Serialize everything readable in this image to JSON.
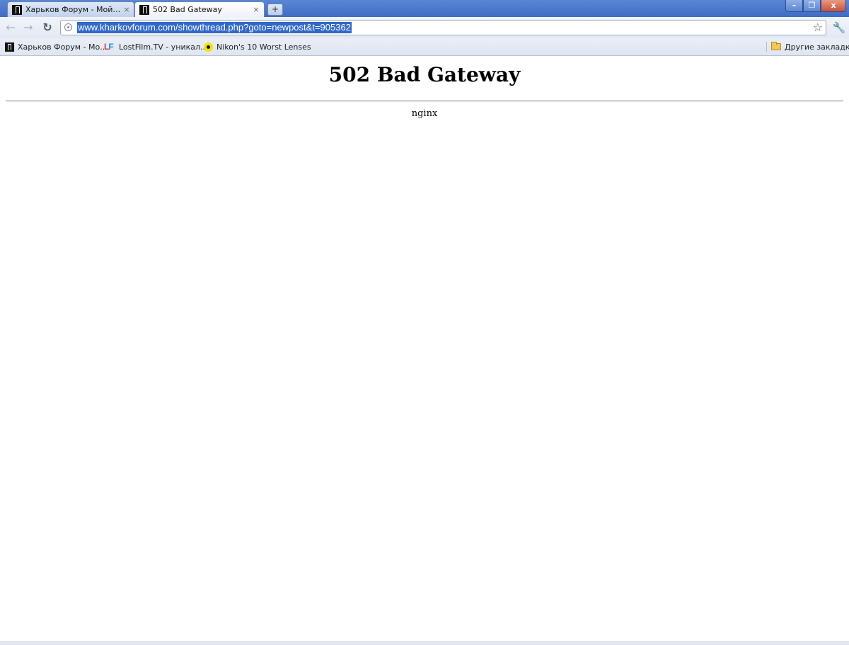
{
  "tabs": [
    {
      "title": "Харьков Форум - Мой каб...",
      "close": "×",
      "active": false
    },
    {
      "title": "502 Bad Gateway",
      "close": "×",
      "active": true
    }
  ],
  "new_tab_label": "+",
  "window_controls": {
    "minimize": "–",
    "maximize": "❐",
    "close": "x"
  },
  "toolbar": {
    "back": "←",
    "forward": "→",
    "reload": "↻",
    "url": "www.kharkovforum.com/showthread.php?goto=newpost&t=905362",
    "star": "☆",
    "wrench": "🔧"
  },
  "bookmarks": {
    "items": [
      {
        "label": "Харьков Форум - Мо...",
        "icon": "kharkov-favicon"
      },
      {
        "label": "LostFilm.TV - уникал...",
        "icon": "lostfilm-favicon",
        "icon_text_l": "L",
        "icon_text_f": "F"
      },
      {
        "label": "Nikon's 10 Worst Lenses",
        "icon": "nikon-favicon"
      }
    ],
    "other": "Другие закладки"
  },
  "page": {
    "title": "502 Bad Gateway",
    "server": "nginx"
  },
  "colors": {
    "tabstrip": "#3f6cc4",
    "url_selection": "#3268c7",
    "page_background": "#ffffff"
  }
}
